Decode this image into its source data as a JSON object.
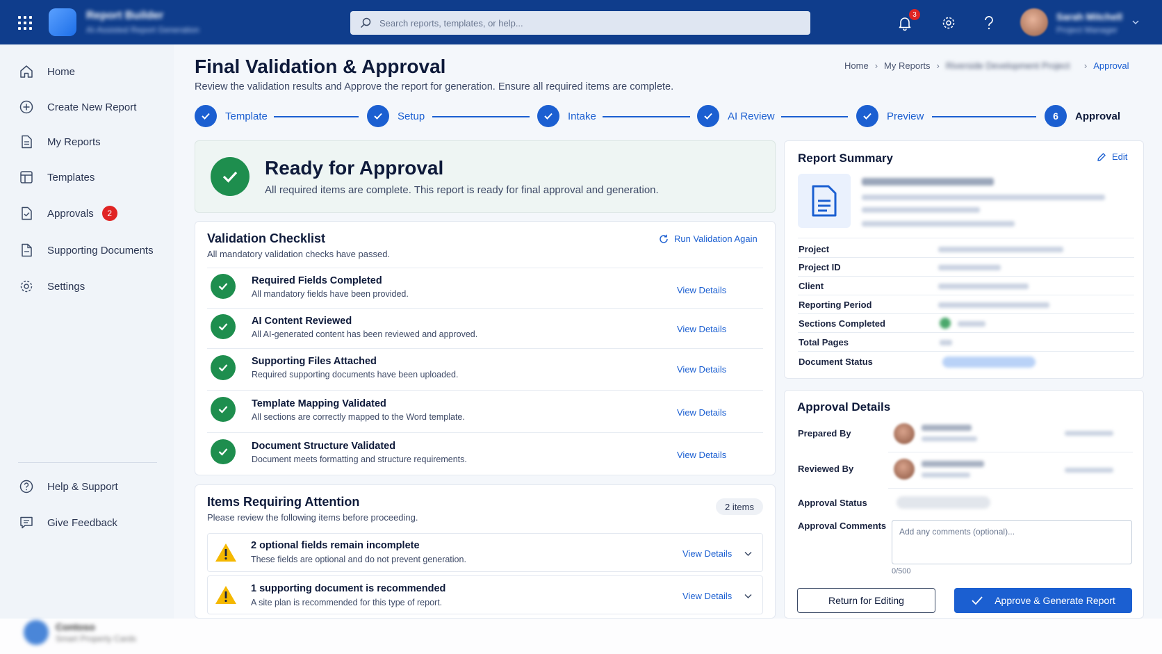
{
  "topbar": {
    "app_name": "Report Builder",
    "app_subtitle": "AI-Assisted Report Generation",
    "search_placeholder": "Search reports, templates, or help...",
    "notifications_count": "3",
    "user_name": "Sarah Mitchell",
    "user_role": "Project Manager"
  },
  "sidebar": {
    "items": [
      {
        "label": "Home",
        "icon": "home-icon"
      },
      {
        "label": "Create New Report",
        "icon": "plus-circle-icon"
      },
      {
        "label": "My Reports",
        "icon": "document-icon"
      },
      {
        "label": "Templates",
        "icon": "templates-icon"
      },
      {
        "label": "Approvals",
        "icon": "approval-icon",
        "badge": "2"
      },
      {
        "label": "Supporting Documents",
        "icon": "attachment-icon"
      },
      {
        "label": "Settings",
        "icon": "gear-icon"
      }
    ],
    "bottom_items": [
      {
        "label": "Help & Support",
        "icon": "help-icon"
      },
      {
        "label": "Give Feedback",
        "icon": "feedback-icon"
      }
    ],
    "footer_title": "Contoso",
    "footer_subtitle": "Smart Property Cards"
  },
  "header": {
    "title": "Final Validation & Approval",
    "subtitle": "Review the validation results and Approve the report for generation. Ensure all required items are complete.",
    "breadcrumb": [
      "Home",
      "My Reports",
      "Riverside Development Project",
      "Approval"
    ]
  },
  "stepper": {
    "steps": [
      {
        "label": "Template",
        "state": "done"
      },
      {
        "label": "Setup",
        "state": "done"
      },
      {
        "label": "Intake",
        "state": "done"
      },
      {
        "label": "AI Review",
        "state": "done"
      },
      {
        "label": "Preview",
        "state": "done"
      },
      {
        "label": "Approval",
        "state": "current",
        "number": "6"
      }
    ]
  },
  "ready": {
    "title": "Ready for Approval",
    "subtitle": "All required items are complete. This report is ready for final approval and generation."
  },
  "checklist": {
    "title": "Validation Checklist",
    "subtitle": "All mandatory validation checks have passed.",
    "run_again": "Run Validation Again",
    "view_label": "View Details",
    "items": [
      {
        "title": "Required Fields Completed",
        "desc": "All mandatory fields have been provided."
      },
      {
        "title": "AI Content Reviewed",
        "desc": "All AI-generated content has been reviewed and approved."
      },
      {
        "title": "Supporting Files Attached",
        "desc": "Required supporting documents have been uploaded."
      },
      {
        "title": "Template Mapping Validated",
        "desc": "All sections are correctly mapped to the Word template."
      },
      {
        "title": "Document Structure Validated",
        "desc": "Document meets formatting and structure requirements."
      }
    ]
  },
  "attention": {
    "title": "Items Requiring Attention",
    "subtitle": "Please review the following items before proceeding.",
    "count": "2 items",
    "view_label": "View Details",
    "items": [
      {
        "title": "2 optional fields remain incomplete",
        "desc": "These fields are optional and do not prevent generation."
      },
      {
        "title": "1 supporting document is recommended",
        "desc": "A site plan is recommended for this type of report."
      }
    ]
  },
  "summary": {
    "title": "Report Summary",
    "edit": "Edit",
    "labels": [
      "Project",
      "Project ID",
      "Client",
      "Reporting Period",
      "Sections Completed",
      "Total Pages",
      "Document Status"
    ]
  },
  "approval": {
    "title": "Approval Details",
    "prepared_by": "Prepared By",
    "reviewed_by": "Reviewed By",
    "status_label": "Approval Status",
    "comments_label": "Approval Comments",
    "comments_placeholder": "Add any comments (optional)...",
    "char_count": "0/500",
    "return_button": "Return for Editing",
    "approve_button": "Approve & Generate Report"
  },
  "colors": {
    "primary": "#1b5fd1",
    "topbar": "#0f3d8c",
    "success": "#1e8e4e",
    "warning": "#f5b800",
    "danger": "#e02424"
  }
}
